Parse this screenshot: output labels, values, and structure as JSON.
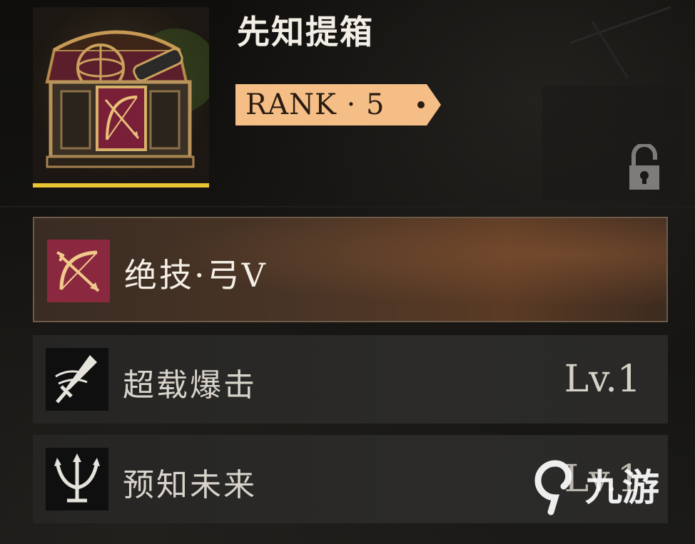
{
  "item": {
    "title": "先知提箱",
    "rank_label": "RANK · 5",
    "art": "treasure-chest-with-bow-emblem",
    "locked": true
  },
  "skills": [
    {
      "name": "绝技·弓V",
      "icon": "bow-icon",
      "level": "",
      "highlight": true
    },
    {
      "name": "超载爆击",
      "icon": "sword-slash-icon",
      "level": "Lv.1",
      "highlight": false
    },
    {
      "name": "预知未来",
      "icon": "trident-icon",
      "level": "Lv.1",
      "highlight": false
    }
  ],
  "colors": {
    "rank_badge": "#f4be86",
    "art_underline": "#e9c433",
    "main_skill_border": "#6d5a48",
    "bow_icon_bg": "#8a2840"
  },
  "watermark": {
    "text": "九游",
    "icon": "jiuyou-logo-icon"
  }
}
